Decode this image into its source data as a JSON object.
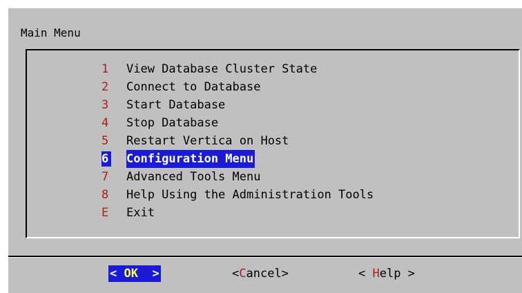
{
  "dialog": {
    "title": "Main Menu"
  },
  "menu": {
    "items": [
      {
        "tag": "1",
        "label": "View Database Cluster State"
      },
      {
        "tag": "2",
        "label": "Connect to Database"
      },
      {
        "tag": "3",
        "label": "Start Database"
      },
      {
        "tag": "4",
        "label": "Stop Database"
      },
      {
        "tag": "5",
        "label": "Restart Vertica on Host"
      },
      {
        "tag": "6",
        "label": "Configuration Menu",
        "selected": true
      },
      {
        "tag": "7",
        "label": "Advanced Tools Menu"
      },
      {
        "tag": "8",
        "label": "Help Using the Administration Tools"
      },
      {
        "tag": "E",
        "label": "Exit"
      }
    ]
  },
  "buttons": {
    "ok": {
      "prefix": "< ",
      "hot": "OK",
      "suffix": "  >"
    },
    "cancel": {
      "prefix": "<",
      "hot": "C",
      "suffix": "ancel>"
    },
    "help": {
      "prefix": "< ",
      "hot": "H",
      "suffix": "elp >"
    }
  },
  "colors": {
    "background": "#c0c0c0",
    "highlight": "#1a1ad8",
    "tag_red": "#b21a1a",
    "hotkey_yellow": "#ffff44"
  }
}
